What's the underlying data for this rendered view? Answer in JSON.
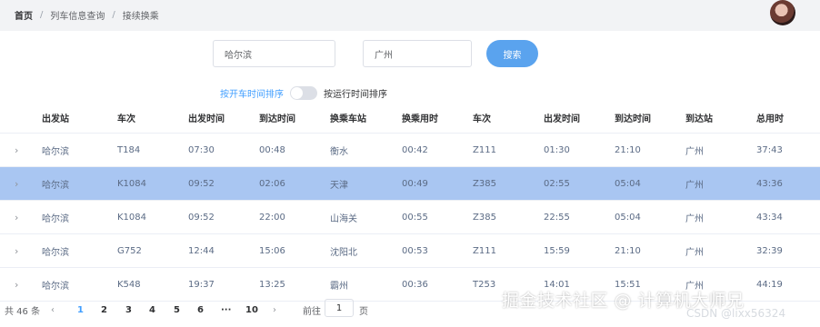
{
  "breadcrumb": {
    "home": "首页",
    "level1": "列车信息查询",
    "level2": "接续换乘",
    "separator": "/"
  },
  "search": {
    "from_value": "哈尔滨",
    "to_value": "广州",
    "button_label": "搜索"
  },
  "sort": {
    "left_label": "按开车时间排序",
    "right_label": "按运行时间排序"
  },
  "table": {
    "headers": [
      "出发站",
      "车次",
      "出发时间",
      "到达时间",
      "换乘车站",
      "换乘用时",
      "车次",
      "出发时间",
      "到达时间",
      "到达站",
      "总用时"
    ],
    "rows": [
      {
        "expand": "›",
        "cells": [
          "哈尔滨",
          "T184",
          "07:30",
          "00:48",
          "衡水",
          "00:42",
          "Z111",
          "01:30",
          "21:10",
          "广州",
          "37:43"
        ]
      },
      {
        "expand": "›",
        "cells": [
          "哈尔滨",
          "K1084",
          "09:52",
          "02:06",
          "天津",
          "00:49",
          "Z385",
          "02:55",
          "05:04",
          "广州",
          "43:36"
        ]
      },
      {
        "expand": "›",
        "cells": [
          "哈尔滨",
          "K1084",
          "09:52",
          "22:00",
          "山海关",
          "00:55",
          "Z385",
          "22:55",
          "05:04",
          "广州",
          "43:34"
        ]
      },
      {
        "expand": "›",
        "cells": [
          "哈尔滨",
          "G752",
          "12:44",
          "15:06",
          "沈阳北",
          "00:53",
          "Z111",
          "15:59",
          "21:10",
          "广州",
          "32:39"
        ]
      },
      {
        "expand": "›",
        "cells": [
          "哈尔滨",
          "K548",
          "19:37",
          "13:25",
          "霸州",
          "00:36",
          "T253",
          "14:01",
          "15:51",
          "广州",
          "44:19"
        ]
      }
    ]
  },
  "pagination": {
    "total": "共 46 条",
    "prev": "‹",
    "pages": [
      "1",
      "2",
      "3",
      "4",
      "5",
      "6"
    ],
    "more": "···",
    "last": "10",
    "next": "›",
    "goto_label": "前往",
    "goto_value": "1",
    "goto_unit": "页"
  },
  "watermark": {
    "main": "掘金技术社区 @ 计算机大师兄",
    "sub": "CSDN @lixx56324"
  },
  "colors": {
    "accent": "#409eff",
    "highlight_row": "#a9c6f2",
    "search_button": "#5aa3ee"
  }
}
